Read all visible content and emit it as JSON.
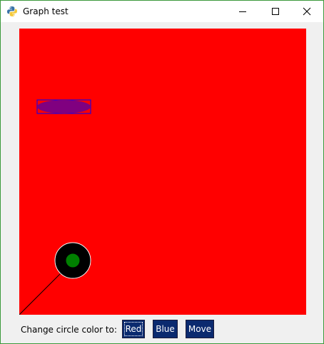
{
  "window": {
    "title": "Graph test"
  },
  "canvas": {
    "background_color": "#ff0000",
    "ellipse": {
      "fill": "#800080",
      "outline": "#0000ff"
    },
    "circle": {
      "outer_fill": "#000000",
      "outer_outline": "#ffffff",
      "inner_fill": "#008000"
    },
    "line": {
      "color": "#000000"
    }
  },
  "controls": {
    "label": "Change circle color to:",
    "buttons": [
      {
        "label": "Red"
      },
      {
        "label": "Blue"
      },
      {
        "label": "Move"
      }
    ],
    "button_color": "#0b2a6f"
  }
}
